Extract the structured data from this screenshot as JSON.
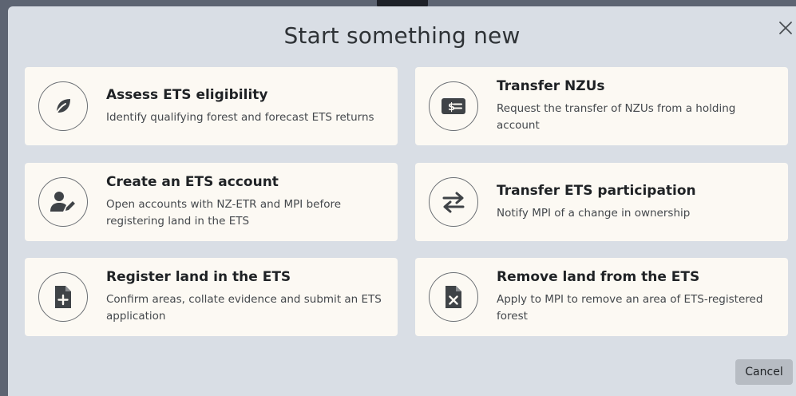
{
  "modal": {
    "title": "Start something new",
    "close_icon": "close-icon",
    "cancel_label": "Cancel"
  },
  "colors": {
    "modal_bg": "#d9dee5",
    "card_bg": "#fcf9f3",
    "icon_stroke": "#6b6f74",
    "title_text": "#1f2225",
    "cancel_bg": "#b7bcc3"
  },
  "cards": [
    {
      "icon": "leaf-icon",
      "title": "Assess ETS eligibility",
      "description": "Identify qualifying forest and forecast ETS returns"
    },
    {
      "icon": "money-transfer-icon",
      "title": "Transfer NZUs",
      "description": "Request the transfer of NZUs from a holding account"
    },
    {
      "icon": "user-edit-icon",
      "title": "Create an ETS account",
      "description": "Open accounts with NZ-ETR and MPI before registering land in the ETS"
    },
    {
      "icon": "exchange-arrows-icon",
      "title": "Transfer ETS participation",
      "description": "Notify MPI of a change in ownership"
    },
    {
      "icon": "file-plus-icon",
      "title": "Register land in the ETS",
      "description": "Confirm areas, collate evidence and submit an ETS application"
    },
    {
      "icon": "file-remove-icon",
      "title": "Remove land from the ETS",
      "description": "Apply to MPI to remove an area of ETS-registered forest"
    }
  ]
}
